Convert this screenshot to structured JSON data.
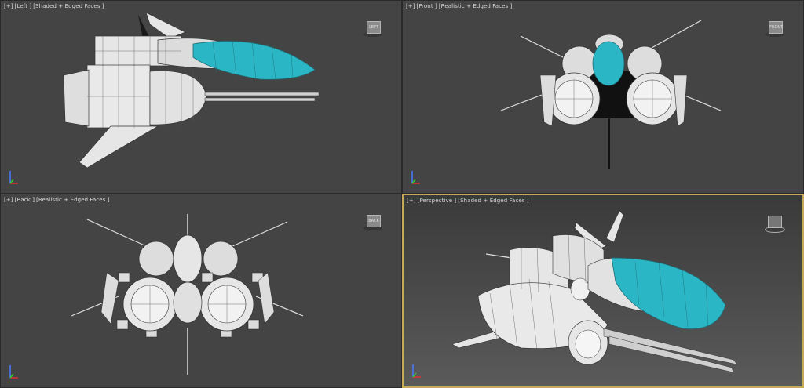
{
  "viewports": [
    {
      "id": "left",
      "menu": "[+]",
      "view": "[Left ]",
      "shading": "[Shaded + Edged Faces ]",
      "viewcube_face": "LEFT",
      "active": false
    },
    {
      "id": "front",
      "menu": "[+]",
      "view": "[Front ]",
      "shading": "[Realistic + Edged Faces ]",
      "viewcube_face": "FRONT",
      "active": false
    },
    {
      "id": "back",
      "menu": "[+]",
      "view": "[Back ]",
      "shading": "[Realistic + Edged Faces ]",
      "viewcube_face": "BACK",
      "active": false
    },
    {
      "id": "perspective",
      "menu": "[+]",
      "view": "[Perspective ]",
      "shading": "[Shaded + Edged Faces ]",
      "viewcube_face": "",
      "active": true
    }
  ],
  "colors": {
    "viewport_bg": "#444444",
    "active_border": "#c8a85a",
    "canopy": "#2ab6c4",
    "hull": "#e6e6e6",
    "wire": "#333333"
  },
  "icons": [
    "viewcube-icon",
    "axis-tripod-icon"
  ]
}
